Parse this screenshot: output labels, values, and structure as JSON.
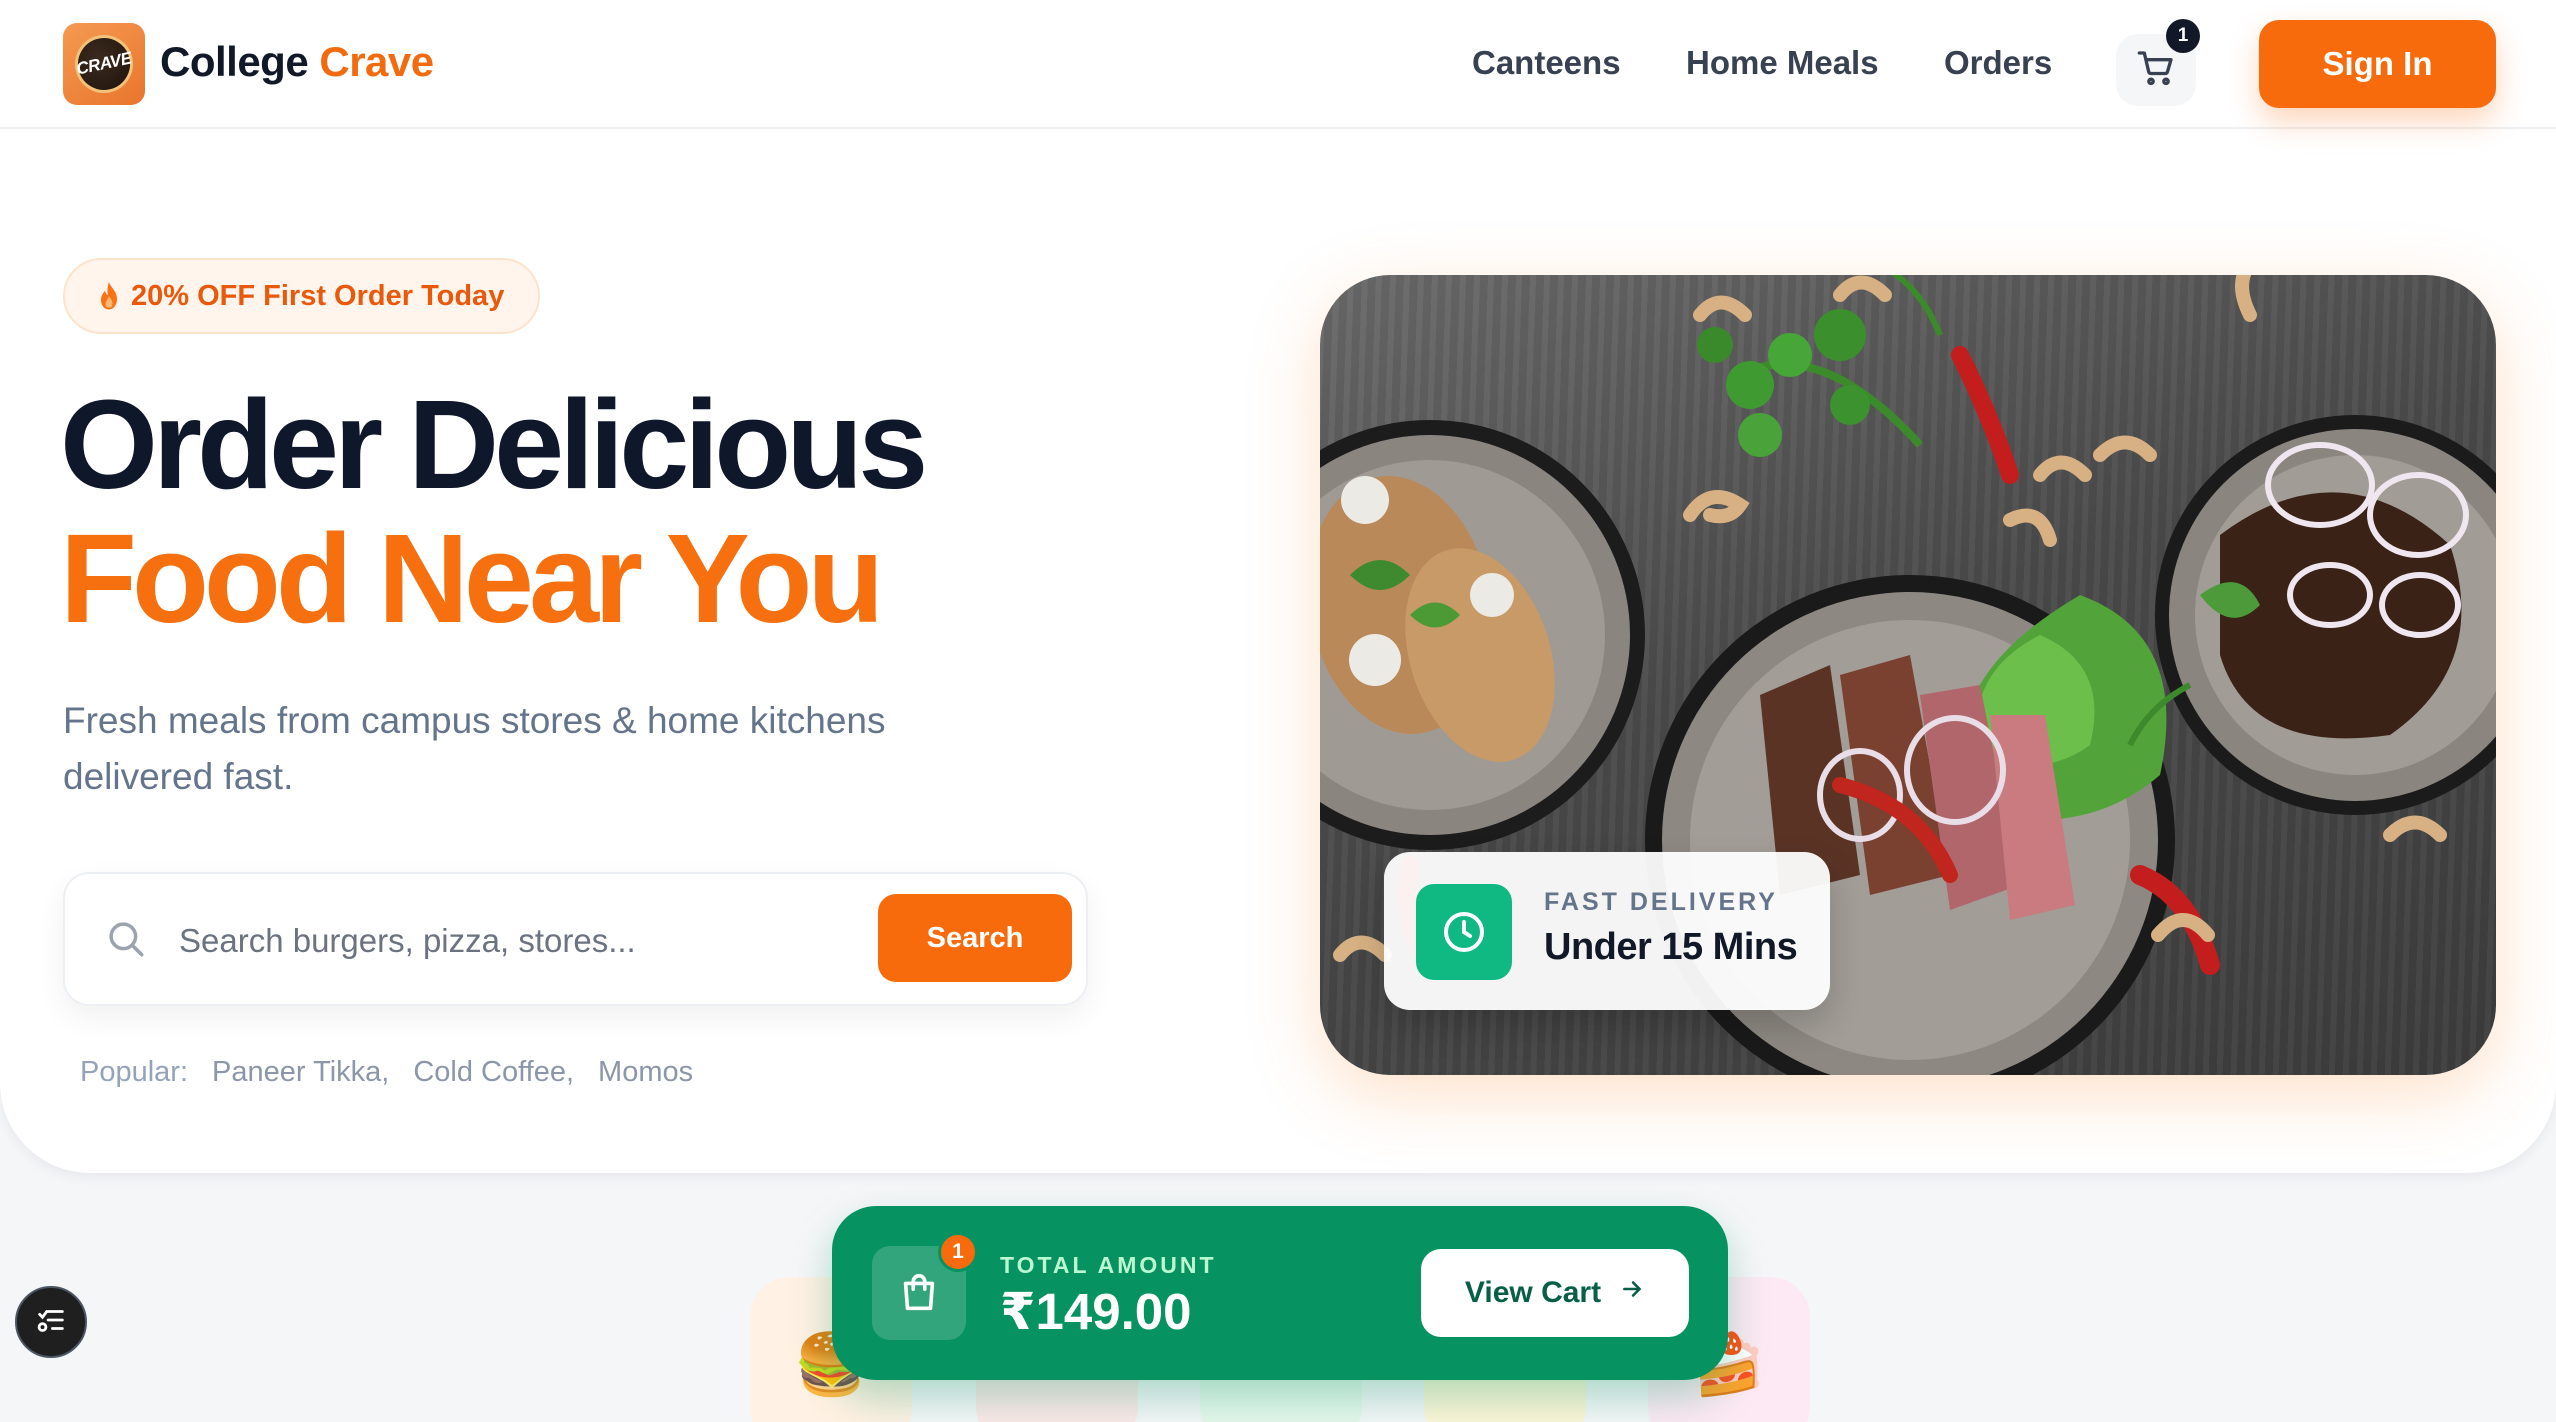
{
  "brand": {
    "logo_text": "CRAVE",
    "name_part1": "College",
    "name_part2": "Crave"
  },
  "nav": {
    "links": [
      {
        "label": "Canteens"
      },
      {
        "label": "Home Meals"
      },
      {
        "label": "Orders"
      }
    ],
    "cart_count": "1",
    "signin_label": "Sign In"
  },
  "hero": {
    "promo": "20% OFF First Order Today",
    "headline_line1": "Order Delicious",
    "headline_line2": "Food Near You",
    "subtext": "Fresh meals from campus stores & home kitchens delivered fast.",
    "search": {
      "placeholder": "Search burgers, pizza, stores...",
      "value": "",
      "button_label": "Search"
    },
    "popular_label": "Popular:",
    "popular_tags": [
      "Paneer Tikka,",
      "Cold Coffee,",
      "Momos"
    ],
    "delivery_card": {
      "label": "FAST DELIVERY",
      "value": "Under 15 Mins"
    }
  },
  "categories": [
    {
      "icon": "burger-icon",
      "emoji": "🍔",
      "color": "#fff1e3"
    },
    {
      "icon": "pizza-icon",
      "emoji": "",
      "color": "#fde8e8"
    },
    {
      "icon": "bowl-icon",
      "emoji": "",
      "color": "#e6f7ec"
    },
    {
      "icon": "fries-icon",
      "emoji": "",
      "color": "#fdf6d8"
    },
    {
      "icon": "cake-icon",
      "emoji": "🍰",
      "color": "#fde9f3"
    }
  ],
  "cart_bar": {
    "item_count": "1",
    "total_label": "TOTAL AMOUNT",
    "total_value": "₹149.00",
    "button_label": "View Cart"
  },
  "colors": {
    "accent": "#f86b0d",
    "heading": "#0f172a",
    "cart_bar": "#069261",
    "delivery_icon": "#10b981"
  }
}
